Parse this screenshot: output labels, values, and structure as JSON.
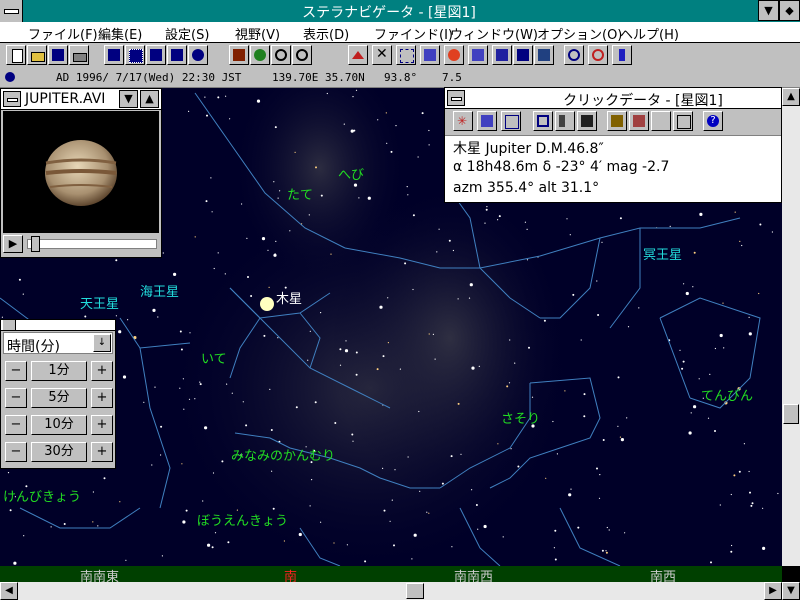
{
  "window": {
    "title": "ステラナビゲータ - [星図1]",
    "minimize_symbol": "▼",
    "maximize_symbol": "▲",
    "restore_symbol": "◆"
  },
  "menu": [
    "ファイル(F)",
    "編集(E)",
    "設定(S)",
    "視野(V)",
    "表示(D)",
    "ファインド(I)",
    "ウィンドウ(W)",
    "オプション(O)",
    "ヘルプ(H)"
  ],
  "toolbar_icons": [
    "new-icon",
    "open-icon",
    "save-icon",
    "print-icon",
    "star-chart-icon",
    "grid-icon",
    "sky-icon",
    "earth-icon",
    "globe-icon",
    "horizon-icon",
    "planet-icon",
    "zoom-in-icon",
    "zoom-out-icon",
    "constellation-icon",
    "cross-icon",
    "compass-icon",
    "rotate-icon",
    "mars-icon",
    "comet-icon",
    "pen-icon",
    "map-icon",
    "list-icon",
    "target-icon",
    "clock-icon",
    "run-icon"
  ],
  "status": {
    "date": "AD 1996/ 7/17(Wed) 22:30 JST",
    "location": "139.70E 35.70N",
    "angle": "93.8°",
    "magnitude": "7.5"
  },
  "movie": {
    "title": "JUPITER.AVI",
    "play_symbol": "▶"
  },
  "time_panel": {
    "unit_selected": "時間(分)",
    "dropdown_symbol": "↓",
    "minus_symbol": "−",
    "plus_symbol": "+",
    "steps": [
      "1分",
      "5分",
      "10分",
      "30分"
    ]
  },
  "click_data": {
    "title": "クリックデータ - [星図1]",
    "tool_icons": [
      "star-burst-icon",
      "chart-icon",
      "grid-icon",
      "screen-icon",
      "speaker-icon",
      "film-icon",
      "bug-icon",
      "paint-icon",
      "blank-icon",
      "copy-icon",
      "help-icon"
    ],
    "line1": "木星 Jupiter   D.M.46.8″",
    "line2": "α 18h48.6m   δ -23° 4′  mag -2.7",
    "line3": "azm 355.4°  alt 31.1°"
  },
  "sky_labels": {
    "hebi": "へび",
    "tate": "たて",
    "meiousei": "冥王星",
    "mokusei": "木星",
    "kaiousei": "海王星",
    "tennousei": "天王星",
    "ite": "いて",
    "sasori": "さそり",
    "tenbin": "てんびん",
    "minamikanmuri": "みなみのかんむり",
    "kenbikyou": "けんびきょう",
    "bouenkyou": "ぼうえんきょう"
  },
  "directions": {
    "sse": "南南東",
    "s": "南",
    "ssw": "南南西",
    "sw": "南西"
  },
  "scroll": {
    "left": "◀",
    "right": "▶",
    "up": "▲",
    "down": "▼"
  },
  "colors": {
    "titlebar": "#008080",
    "sky": "#000028",
    "constellation_line": "#4080c0",
    "label_green": "#22dd22",
    "label_cyan": "#22dddd",
    "direction_south": "#ff2020"
  }
}
